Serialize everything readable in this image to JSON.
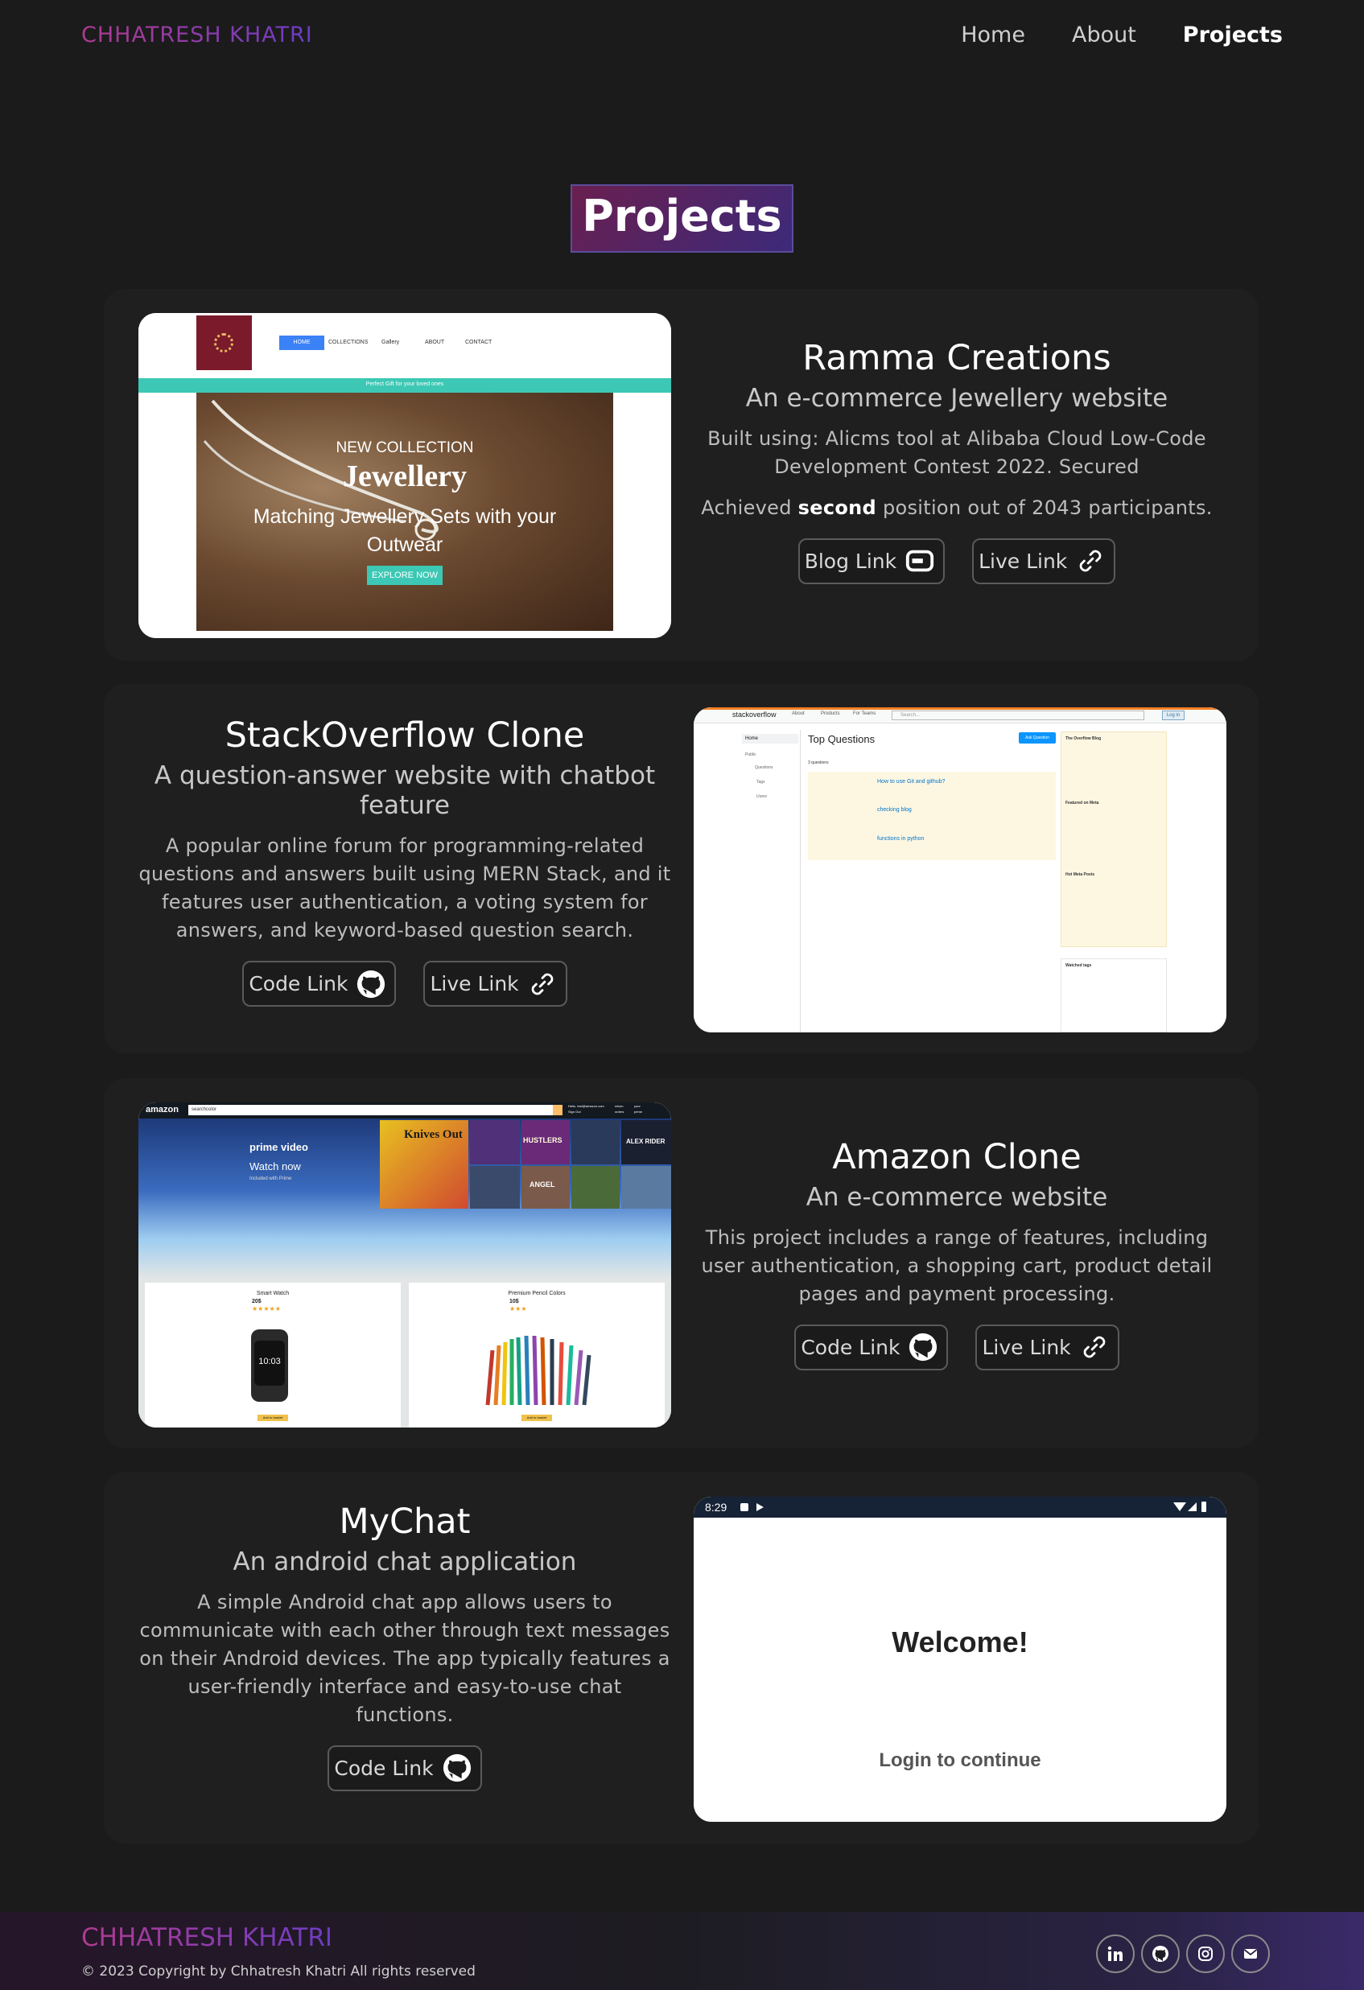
{
  "nav": {
    "brand": "CHHATRESH KHATRI",
    "links": [
      "Home",
      "About",
      "Projects"
    ]
  },
  "page_title": "Projects",
  "projects": [
    {
      "name": "Ramma Creations",
      "subtitle": "An e-commerce Jewellery website",
      "desc1": "Built using: Alicms tool at Alibaba Cloud Low-Code Development Contest 2022. Secured",
      "desc2_pre": "Achieved ",
      "desc2_bold": "second",
      "desc2_post": " position out of 2043 participants.",
      "buttons": [
        "Blog Link",
        "Live Link"
      ],
      "shot": {
        "menu": [
          "HOME",
          "COLLECTIONS",
          "Gallery",
          "ABOUT",
          "CONTACT"
        ],
        "strip": "Perfect Gift for your loved ones",
        "tag": "NEW COLLECTION",
        "heading": "Jewellery",
        "caption": "Matching Jewellery Sets with your Outwear",
        "cta": "EXPLORE NOW"
      }
    },
    {
      "name": "StackOverflow Clone",
      "subtitle": "A question-answer website with chatbot feature",
      "desc": "A popular online forum for programming-related questions and answers built using MERN Stack, and it features user authentication, a voting system for answers, and keyword-based question search.",
      "buttons": [
        "Code Link",
        "Live Link"
      ],
      "shot": {
        "logo": "stackoverflow",
        "top_links": [
          "About",
          "Products",
          "For Teams"
        ],
        "search": "Search...",
        "login": "Log in",
        "side": [
          "Home",
          "Public",
          "Questions",
          "Tags",
          "Users"
        ],
        "heading": "Top Questions",
        "ask": "Ask Question",
        "count": "3 questions",
        "questions": [
          "How to use Git and github?",
          "checking blog",
          "functions in python"
        ],
        "blog_title": "The Overflow Blog",
        "featured": "Featured on Meta",
        "hot": "Hot Meta Posts",
        "watched": "Watched tags"
      }
    },
    {
      "name": "Amazon Clone",
      "subtitle": "An e-commerce website",
      "desc": "This project includes a range of features, including user authentication, a shopping cart, product detail pages and payment processing.",
      "buttons": [
        "Code Link",
        "Live Link"
      ],
      "shot": {
        "logo": "amazon",
        "search": "searchcolor",
        "hello": "Hello, test@amazon.com",
        "signout": "Sign Out",
        "returns": "return",
        "orders": "orders",
        "your": "your",
        "prime": "prime",
        "prime_video": "prime video",
        "watch": "Watch now",
        "included": "Included with Prime",
        "banners": [
          "Knives Out",
          "HUSTLERS",
          "ALEX RIDER",
          "ANGEL"
        ],
        "products": [
          {
            "name": "Smart Watch",
            "price": "20$",
            "stars": "★★★★★",
            "btn": "Add to basket"
          },
          {
            "name": "Premium Pencil Colors",
            "price": "10$",
            "stars": "★★★",
            "btn": "Add to basket"
          }
        ],
        "watch_time": "10:03"
      }
    },
    {
      "name": "MyChat",
      "subtitle": "An android chat application",
      "desc": "A simple Android chat app allows users to communicate with each other through text messages on their Android devices. The app typically features a user-friendly interface and easy-to-use chat functions.",
      "buttons": [
        "Code Link"
      ],
      "shot": {
        "time": "8:29",
        "welcome": "Welcome!",
        "login": "Login to continue"
      }
    }
  ],
  "footer": {
    "brand": "CHHATRESH KHATRI",
    "copyright": "© 2023 Copyright by Chhatresh Khatri All rights reserved",
    "socials": [
      "linkedin-icon",
      "github-icon",
      "instagram-icon",
      "mail-icon"
    ]
  }
}
